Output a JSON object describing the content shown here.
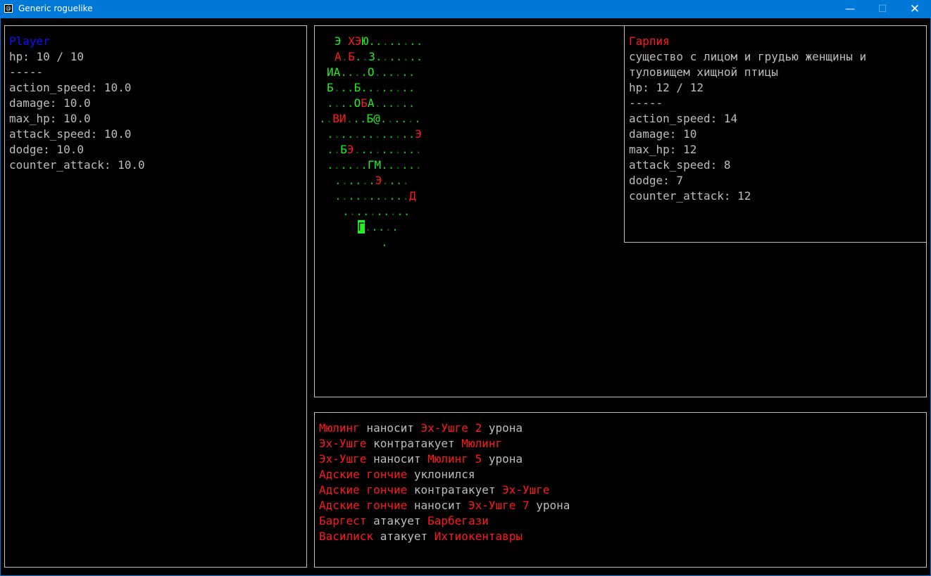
{
  "window": {
    "title": "Generic roguelike",
    "controls": [
      "—",
      "☐",
      "✕"
    ]
  },
  "player": {
    "name": "Player",
    "hp_line": "hp: 10 / 10",
    "separator": "-----",
    "stats": [
      "action_speed: 10.0",
      "damage: 10.0",
      "max_hp: 10.0",
      "attack_speed: 10.0",
      "dodge: 10.0",
      "counter_attack: 10.0"
    ]
  },
  "map": {
    "rows": [
      "Э XЭЮ........",
      "А.Б..З.......",
      "ИА....О......",
      "Б...Б........",
      "....ОБА......",
      "..ВИ...Б@......",
      ".............Э",
      "..БЭ..........",
      "......ГМ......",
      "......Э....",
      "...........Д",
      "..........",
      "Г.....",
      "."
    ]
  },
  "target": {
    "name": "Гарпия",
    "desc1": "существо с лицом и грудью женщины и",
    "desc2": "туловищем хищной птицы",
    "hp_line": "hp: 12 / 12",
    "separator": "-----",
    "stats": [
      "action_speed: 14",
      "damage: 10",
      "max_hp: 12",
      "attack_speed: 8",
      "dodge: 7",
      "counter_attack: 12"
    ]
  },
  "log": [
    {
      "a": "Мюлинг",
      "verb": " наносит ",
      "b": "Эх-Ушге 2",
      "tail": " урона"
    },
    {
      "a": "Эх-Ушге",
      "verb": " контратакует ",
      "b": "Мюлинг",
      "tail": ""
    },
    {
      "a": "Эх-Ушге",
      "verb": " наносит ",
      "b": "Мюлинг 5",
      "tail": " урона"
    },
    {
      "a": "Адские гончие",
      "verb": " уклонился",
      "b": "",
      "tail": ""
    },
    {
      "a": "Адские гончие",
      "verb": " контратакует ",
      "b": "Эх-Ушге",
      "tail": ""
    },
    {
      "a": "Адские гончие",
      "verb": " наносит ",
      "b": "Эх-Ушге 7",
      "tail": " урона"
    },
    {
      "a": "Баргест",
      "verb": " атакует ",
      "b": "Барбегази",
      "tail": ""
    },
    {
      "a": "Василиск",
      "verb": " атакует ",
      "b": "Ихтиокентавры",
      "tail": ""
    }
  ],
  "colors": {
    "titlebar": "#0078d7",
    "enemy_red": "#ff1a1a",
    "map_green": "#22ee22",
    "player_blue": "#1010ff",
    "text_grey": "#bdbdbd"
  }
}
